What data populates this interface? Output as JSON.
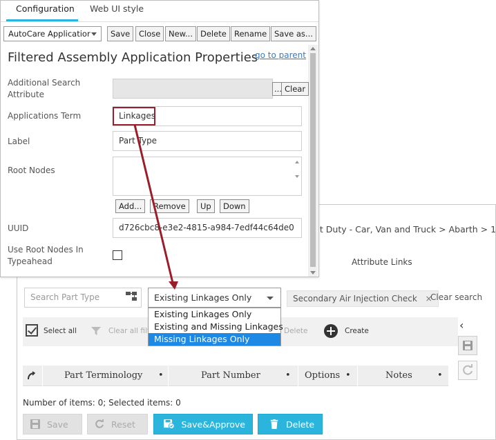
{
  "back_panel": {
    "breadcrumb": "nt Duty - Car, Van and Truck > Abarth > 1000",
    "partial_tab": "y",
    "attribute_links_tab": "Attribute Links",
    "search_placeholder": "Search Part Type",
    "linkage_filter": {
      "selected": "Existing Linkages Only",
      "options": [
        "Existing Linkages Only",
        "Existing and Missing Linkages",
        "Missing Linkages Only"
      ],
      "highlighted_option": "Missing Linkages Only"
    },
    "filter_chip": "Secondary Air Injection Check",
    "chip_remove": "×",
    "clear_search": "Clear search",
    "toolbar": {
      "select_all": "Select all",
      "clear_all_filters": "Clear all filte",
      "delete": "Delete",
      "create": "Create"
    },
    "side_chevron": "‹",
    "table_columns": [
      "Part Terminology",
      "Part Number",
      "Options",
      "Notes"
    ],
    "items_count_text": "Number of items: 0; Selected items: 0",
    "footer_buttons": {
      "save": "Save",
      "reset": "Reset",
      "save_approve": "Save&Approve",
      "delete": "Delete"
    },
    "colors": {
      "primary": "#2bb5dd",
      "dropdown_highlight": "#1e88e5"
    }
  },
  "front_panel": {
    "tabs": [
      "Configuration",
      "Web UI style"
    ],
    "active_tab": "Configuration",
    "config_combo": "AutoCare Applicatior",
    "toolbar_buttons": [
      "Save",
      "Close",
      "New...",
      "Delete",
      "Rename",
      "Save as..."
    ],
    "title": "Filtered Assembly Application Properties",
    "go_to_parent": "go to parent",
    "fields": {
      "additional_search_attribute": {
        "label": "Additional Search Attribute",
        "value": "",
        "browse": "...",
        "clear": "Clear"
      },
      "applications_term": {
        "label": "Applications Term",
        "value": "Linkages"
      },
      "label": {
        "label": "Label",
        "value": "Part Type"
      },
      "root_nodes": {
        "label": "Root Nodes",
        "buttons": [
          "Add...",
          "Remove",
          "Up",
          "Down"
        ]
      },
      "uuid": {
        "label": "UUID",
        "value": "d726cbc8-e3e2-4815-a984-7edf44c64de0"
      },
      "use_root_nodes_in_typeahead": {
        "label": "Use Root Nodes In Typeahead",
        "checked": false
      }
    },
    "colors": {
      "highlight_border": "#9b1c2a",
      "tab_underline": "#2bb5dd"
    }
  }
}
